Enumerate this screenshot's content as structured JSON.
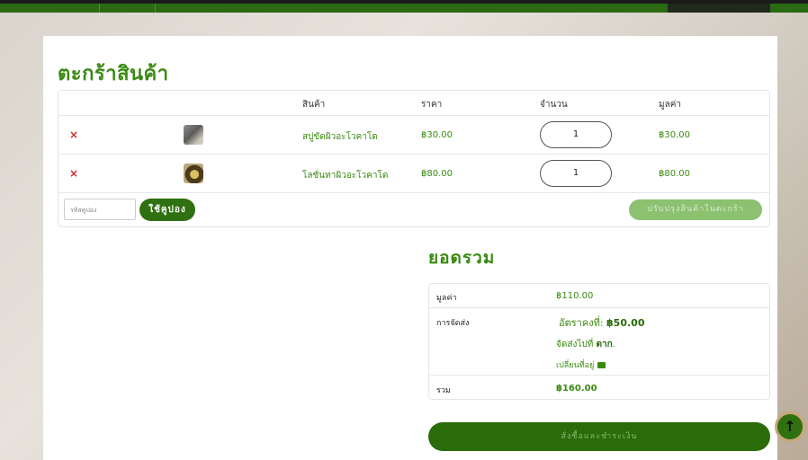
{
  "page": {
    "title": "ตะกร้าสินค้า"
  },
  "cart": {
    "headers": {
      "product": "สินค้า",
      "price": "ราคา",
      "quantity": "จำนวน",
      "subtotal": "มูลค่า"
    },
    "items": [
      {
        "remove": "×",
        "thumb": "soap-product-image",
        "name": "สบู่ขัดผิวอะโวคาโด",
        "price": "฿30.00",
        "qty": "1",
        "subtotal": "฿30.00"
      },
      {
        "remove": "×",
        "thumb": "lotion-product-image",
        "name": "โลชั่นทาผิวอะโวคาโด",
        "price": "฿80.00",
        "qty": "1",
        "subtotal": "฿80.00"
      }
    ],
    "coupon_placeholder": "รหัสคูปอง",
    "coupon_button": "ใช้คูปอง",
    "update_button": "ปรับปรุงสินค้าในตะกร้า"
  },
  "totals": {
    "title": "ยอดรวม",
    "subtotal_label": "มูลค่า",
    "subtotal_value": "฿110.00",
    "shipping_label": "การจัดส่ง",
    "shipping_rate_prefix": "อัตราคงที่: ",
    "shipping_rate_value": "฿50.00",
    "ship_to_prefix": "จัดส่งไปที่ ",
    "ship_to_place": "ตาก",
    "ship_to_suffix": ".",
    "change_address": "เปลี่ยนที่อยู่",
    "total_label": "รวม",
    "total_value": "฿160.00"
  },
  "checkout_button": "สั่งซื้อและชำระเงิน",
  "scroll_top_icon": "↑",
  "icons": {
    "remove": "close-icon",
    "truck": "truck-icon",
    "scroll_top": "arrow-up-icon"
  },
  "colors": {
    "accent": "#3a8a12",
    "button": "#2a6b0a",
    "remove": "#d42a2a"
  }
}
